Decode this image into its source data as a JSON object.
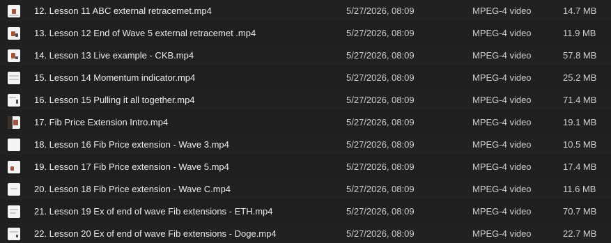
{
  "files": [
    {
      "name": "12. Lesson 11 ABC external retracemet.mp4",
      "date": "5/27/2026, 08:09",
      "type": "MPEG-4 video",
      "size": "14.7 MB",
      "icon": "video-thumbnail-icon"
    },
    {
      "name": "13. Lesson 12 End of Wave 5 external retracemet .mp4",
      "date": "5/27/2026, 08:09",
      "type": "MPEG-4 video",
      "size": "11.9 MB",
      "icon": "video-thumbnail-icon"
    },
    {
      "name": "14. Lesson 13 Live example - CKB.mp4",
      "date": "5/27/2026, 08:09",
      "type": "MPEG-4 video",
      "size": "57.8 MB",
      "icon": "video-thumbnail-icon"
    },
    {
      "name": "15. Lesson 14 Momentum indicator.mp4",
      "date": "5/27/2026, 08:09",
      "type": "MPEG-4 video",
      "size": "25.2 MB",
      "icon": "video-thumbnail-icon"
    },
    {
      "name": "16. Lesson 15 Pulling it all together.mp4",
      "date": "5/27/2026, 08:09",
      "type": "MPEG-4 video",
      "size": "71.4 MB",
      "icon": "video-thumbnail-icon"
    },
    {
      "name": "17. Fib Price Extension Intro.mp4",
      "date": "5/27/2026, 08:09",
      "type": "MPEG-4 video",
      "size": "19.1 MB",
      "icon": "video-thumbnail-icon"
    },
    {
      "name": "18. Lesson 16 Fib Price extension - Wave 3.mp4",
      "date": "5/27/2026, 08:09",
      "type": "MPEG-4 video",
      "size": "10.5 MB",
      "icon": "video-thumbnail-icon"
    },
    {
      "name": "19. Lesson 17 Fib Price extension - Wave 5.mp4",
      "date": "5/27/2026, 08:09",
      "type": "MPEG-4 video",
      "size": "17.4 MB",
      "icon": "video-thumbnail-icon"
    },
    {
      "name": "20. Lesson 18 Fib Price extension - Wave C.mp4",
      "date": "5/27/2026, 08:09",
      "type": "MPEG-4 video",
      "size": "11.6 MB",
      "icon": "video-thumbnail-icon"
    },
    {
      "name": "21. Lesson 19 Ex of end of wave Fib extensions - ETH.mp4",
      "date": "5/27/2026, 08:09",
      "type": "MPEG-4 video",
      "size": "70.7 MB",
      "icon": "video-thumbnail-icon"
    },
    {
      "name": "22. Lesson 20 Ex of end of wave Fib extensions - Doge.mp4",
      "date": "5/27/2026, 08:09",
      "type": "MPEG-4 video",
      "size": "22.7 MB",
      "icon": "video-thumbnail-icon"
    }
  ]
}
